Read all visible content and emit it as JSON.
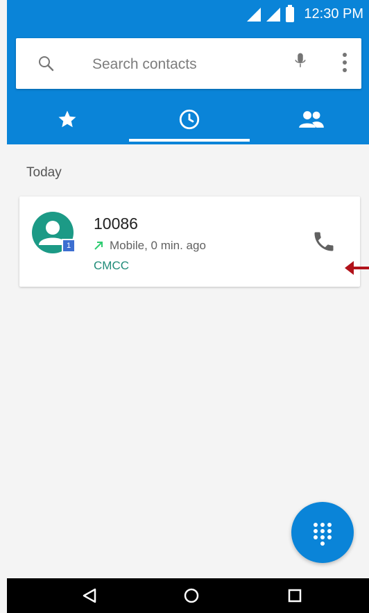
{
  "status_bar": {
    "time": "12:30 PM",
    "signal_icon_1": "signal-icon",
    "signal_icon_2": "signal-icon",
    "battery_icon": "battery-icon"
  },
  "search": {
    "placeholder": "Search contacts",
    "search_icon": "search-icon",
    "mic_icon": "mic-icon",
    "more_icon": "more-vert-icon"
  },
  "tabs": [
    {
      "icon": "star-icon",
      "active": false
    },
    {
      "icon": "clock-icon",
      "active": true
    },
    {
      "icon": "people-icon",
      "active": false
    }
  ],
  "section": {
    "title": "Today"
  },
  "calls": [
    {
      "number": "10086",
      "meta": "Mobile, 0 min. ago",
      "carrier": "CMCC",
      "sim_badge": "1",
      "avatar_icon": "person-icon",
      "direction_icon": "outgoing-call-icon",
      "action_icon": "phone-icon"
    }
  ],
  "fab": {
    "icon": "dialpad-icon"
  },
  "navbar": {
    "back_icon": "back-icon",
    "home_icon": "home-icon",
    "recents_icon": "recents-icon"
  },
  "colors": {
    "primary": "#0a84d8",
    "avatar": "#1c9a86",
    "carrier_text": "#1f8b78",
    "outgoing_arrow": "#2ecc71",
    "annotation": "#b1121a",
    "sim_badge": "#3d6fd1"
  }
}
